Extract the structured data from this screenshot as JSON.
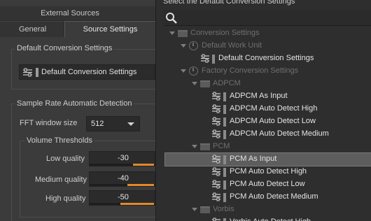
{
  "tabs": {
    "external_sources": "External Sources",
    "general": "General",
    "source_settings": "Source Settings"
  },
  "default_conversion": {
    "group_title": "Default Conversion Settings",
    "value": "Default Conversion Settings"
  },
  "sample_rate": {
    "group_title": "Sample Rate Automatic Detection",
    "fft_label": "FFT window size",
    "fft_value": "512",
    "volume_title": "Volume Thresholds",
    "low_label": "Low quality",
    "low_value": "-30",
    "medium_label": "Medium quality",
    "medium_value": "-40",
    "high_label": "High quality",
    "high_value": "-50"
  },
  "dialog": {
    "title": "Select the Default Conversion Settings"
  },
  "tree": [
    {
      "label": "Conversion Settings",
      "type": "folder",
      "level": 0,
      "dim": true
    },
    {
      "label": "Default Work Unit",
      "type": "workunit",
      "level": 1,
      "dim": true
    },
    {
      "label": "Default Conversion Settings",
      "type": "setting",
      "level": 2,
      "dim": false
    },
    {
      "label": "Factory Conversion Settings",
      "type": "workunit",
      "level": 1,
      "dim": true
    },
    {
      "label": "ADPCM",
      "type": "folder",
      "level": 2,
      "dim": true
    },
    {
      "label": "ADPCM As Input",
      "type": "setting",
      "level": 3,
      "dim": false
    },
    {
      "label": "ADPCM Auto Detect High",
      "type": "setting",
      "level": 3,
      "dim": false
    },
    {
      "label": "ADPCM Auto Detect Low",
      "type": "setting",
      "level": 3,
      "dim": false
    },
    {
      "label": "ADPCM Auto Detect Medium",
      "type": "setting",
      "level": 3,
      "dim": false
    },
    {
      "label": "PCM",
      "type": "folder",
      "level": 2,
      "dim": true
    },
    {
      "label": "PCM As Input",
      "type": "setting",
      "level": 3,
      "dim": false,
      "selected": true
    },
    {
      "label": "PCM Auto Detect High",
      "type": "setting",
      "level": 3,
      "dim": false
    },
    {
      "label": "PCM Auto Detect Low",
      "type": "setting",
      "level": 3,
      "dim": false
    },
    {
      "label": "PCM Auto Detect Medium",
      "type": "setting",
      "level": 3,
      "dim": false
    },
    {
      "label": "Vorbis",
      "type": "folder",
      "level": 2,
      "dim": true
    },
    {
      "label": "Vorbis Auto Detect High",
      "type": "setting",
      "level": 3,
      "dim": false
    }
  ],
  "colors": {
    "accent": "#e08a2a",
    "selection": "#5d5d5d"
  }
}
